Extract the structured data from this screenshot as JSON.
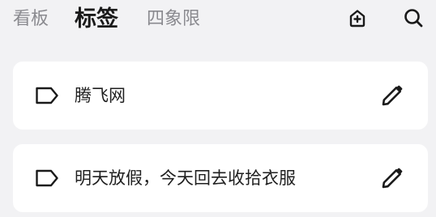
{
  "header": {
    "tabs": [
      {
        "label": "看板",
        "active": false
      },
      {
        "label": "标签",
        "active": true
      },
      {
        "label": "四象限",
        "active": false
      }
    ],
    "icons": [
      "add-home-icon",
      "search-icon"
    ]
  },
  "tags": [
    {
      "label": "腾飞网",
      "icon": "tag-icon",
      "action_icon": "pencil-icon"
    },
    {
      "label": "明天放假，今天回去收拾衣服",
      "icon": "tag-icon",
      "action_icon": "pencil-icon"
    }
  ],
  "colors": {
    "background": "#f2f2f4",
    "card": "#ffffff",
    "text_primary": "#1a1a1a",
    "text_muted": "#8a8a8f"
  }
}
